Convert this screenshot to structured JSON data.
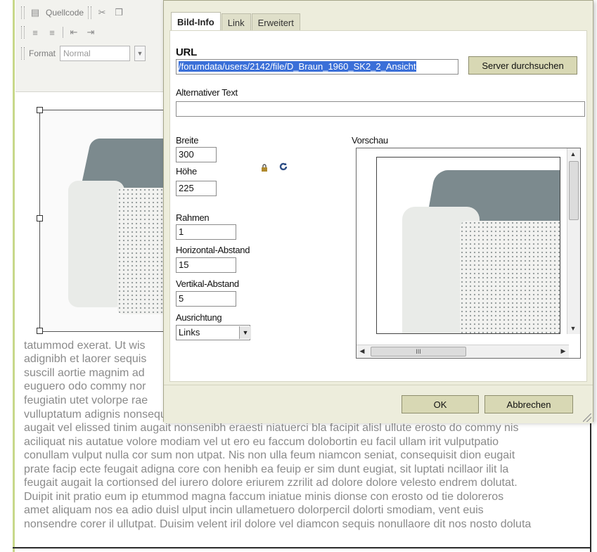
{
  "toolbar": {
    "source_label": "Quellcode",
    "format_label": "Format",
    "format_value": "Normal"
  },
  "dialog": {
    "tabs": [
      "Bild-Info",
      "Link",
      "Erweitert"
    ],
    "url_label": "URL",
    "url_value": "/forumdata/users/2142/file/D_Braun_1960_SK2_2_Ansicht",
    "browse_button": "Server durchsuchen",
    "alt_label": "Alternativer Text",
    "alt_value": "",
    "width_label": "Breite",
    "width_value": "300",
    "height_label": "Höhe",
    "height_value": "225",
    "border_label": "Rahmen",
    "border_value": "1",
    "hspace_label": "Horizontal-Abstand",
    "hspace_value": "15",
    "vspace_label": "Vertikal-Abstand",
    "vspace_value": "5",
    "align_label": "Ausrichtung",
    "align_value": "Links",
    "preview_label": "Vorschau",
    "ok_button": "OK",
    "cancel_button": "Abbrechen",
    "hscroll_thumb_label": "III"
  },
  "body_text": {
    "short_lines": [
      "tatummod exerat. Ut wis",
      "adignibh et laorer sequis",
      "suscill aortie magnim ad",
      "euguero odo commy nor",
      "feugiatin utet volorpe rae"
    ],
    "long_lines": [
      "vulluptatum adignis nonsequi ea facipit del ut pratem verat enim ureros num zzrit luptatem dolent",
      "augait vel elissed tinim augait nonsenibh eraesti niatuerci bla facipit alisl ullute erosto do commy nis",
      "aciliquat nis autatue volore modiam vel ut ero eu faccum dolobortin eu facil ullam irit vulputpatio",
      "conullam vulput nulla cor sum non utpat. Nis non ulla feum niamcon seniat, consequisit dion eugait",
      "prate facip ecte feugait adigna core con henibh ea feuip er sim dunt eugiat, sit luptati ncillaor ilit la",
      "feugait augait la cortionsed del iurero dolore eriurem zzrilit ad dolore dolore velesto endrem dolutat.",
      "Duipit init pratio eum ip etummod magna faccum iniatue minis dionse con erosto od tie doloreros",
      "amet aliquam nos ea adio duisl ulput incin ullametuero dolorpercil dolorti smodiam, vent euis",
      "nonsendre corer il ullutpat. Duisim velent iril dolore vel diamcon sequis nonullaore dit nos nosto doluta"
    ]
  }
}
